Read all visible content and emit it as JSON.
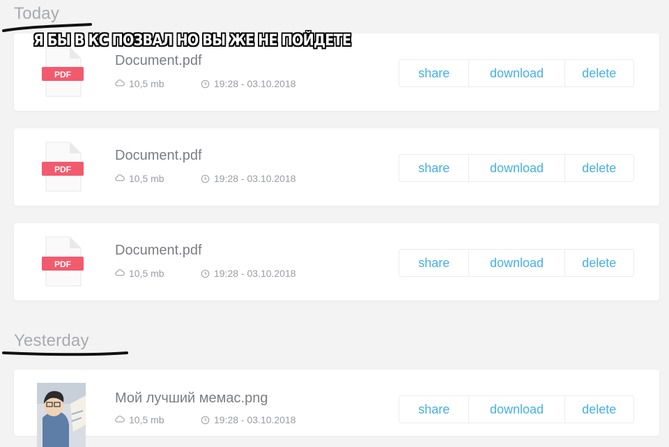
{
  "meme_caption": "Я БЫ В КС ПОЗВАЛ НО ВЫ ЖЕ НЕ ПОЙДЕТЕ",
  "sections": [
    {
      "title": "Today",
      "files": [
        {
          "name": "Document.pdf",
          "size": "10,5 mb",
          "time": "19:28 - 03.10.2018",
          "icon": "pdf-file-icon"
        },
        {
          "name": "Document.pdf",
          "size": "10,5 mb",
          "time": "19:28 - 03.10.2018",
          "icon": "pdf-file-icon"
        },
        {
          "name": "Document.pdf",
          "size": "10,5 mb",
          "time": "19:28 - 03.10.2018",
          "icon": "pdf-file-icon"
        }
      ]
    },
    {
      "title": "Yesterday",
      "files": [
        {
          "name": "Мой лучший мемас.png",
          "size": "10,5 mb",
          "time": "19:28 - 03.10.2018",
          "icon": "image-thumbnail"
        }
      ]
    }
  ],
  "pdf_badge": "PDF",
  "actions": {
    "share": "share",
    "download": "download",
    "delete": "delete"
  },
  "colors": {
    "accent": "#45b0e6",
    "pdf_badge": "#f25a6e",
    "background": "#f3f3f4"
  }
}
